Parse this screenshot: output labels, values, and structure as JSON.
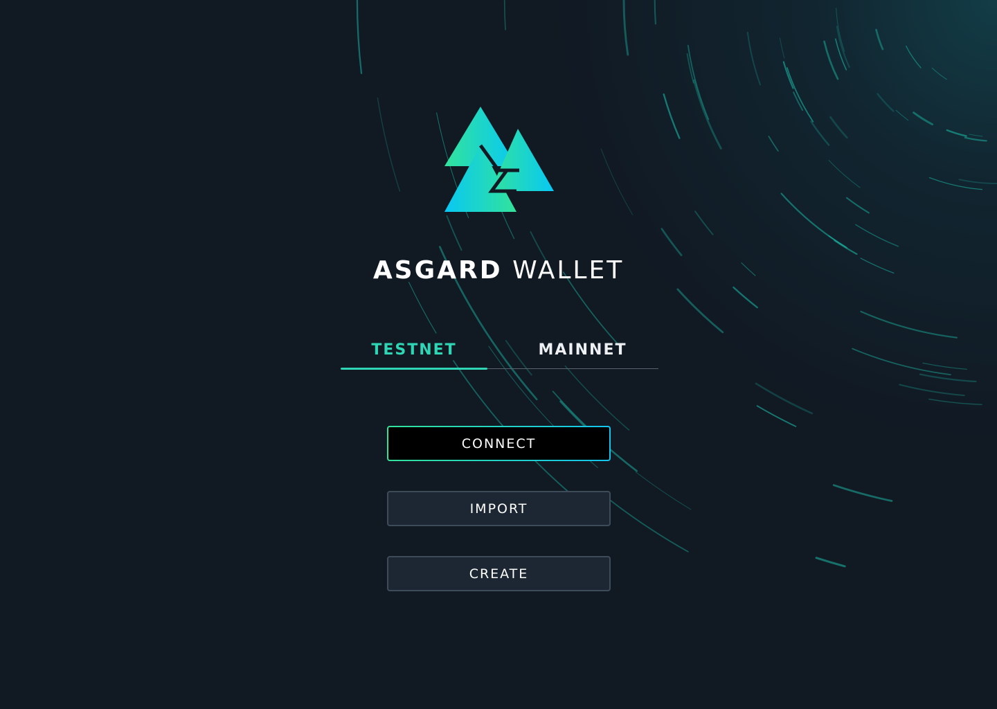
{
  "app": {
    "title_bold": "ASGARD",
    "title_light": "WALLET"
  },
  "tabs": [
    {
      "label": "TESTNET",
      "active": true
    },
    {
      "label": "MAINNET",
      "active": false
    }
  ],
  "actions": {
    "connect_label": "CONNECT",
    "import_label": "IMPORT",
    "create_label": "CREATE"
  },
  "colors": {
    "background": "#111923",
    "accent": "#2fd6b5",
    "logo_gradient_start": "#33e39a",
    "logo_gradient_end": "#08c8f4",
    "button_secondary": "#1c2733"
  }
}
